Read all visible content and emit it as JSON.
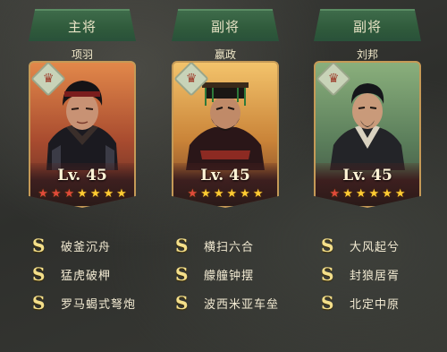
{
  "lineup": [
    {
      "role": "主将",
      "name": "项羽",
      "level": "Lv. 45",
      "rank_icon": "crown-rank-icon",
      "stars": [
        true,
        false,
        false,
        true,
        true,
        true,
        true
      ],
      "skills": [
        {
          "grade": "S",
          "name": "破釜沉舟"
        },
        {
          "grade": "S",
          "name": "猛虎破柙"
        },
        {
          "grade": "S",
          "name": "罗马蝎式弩炮"
        }
      ]
    },
    {
      "role": "副将",
      "name": "嬴政",
      "level": "Lv. 45",
      "rank_icon": "crown-rank-icon",
      "stars": [
        false,
        true,
        true,
        true,
        true,
        true,
        true
      ],
      "skills": [
        {
          "grade": "S",
          "name": "横扫六合"
        },
        {
          "grade": "S",
          "name": "艨艟钟摆"
        },
        {
          "grade": "S",
          "name": "波西米亚车垒"
        }
      ]
    },
    {
      "role": "副将",
      "name": "刘邦",
      "level": "Lv. 45",
      "rank_icon": "crown-rank-icon",
      "stars": [
        false,
        true,
        true,
        true,
        true,
        true,
        true
      ],
      "skills": [
        {
          "grade": "S",
          "name": "大风起兮"
        },
        {
          "grade": "S",
          "name": "封狼居胥"
        },
        {
          "grade": "S",
          "name": "北定中原"
        }
      ]
    }
  ],
  "colors": {
    "role_tab": "#2f5a3b",
    "card_border": "#c59a57",
    "star_gold": "#ffcc33",
    "star_red": "#e04a3a",
    "skill_grade": "#f4df8a"
  }
}
